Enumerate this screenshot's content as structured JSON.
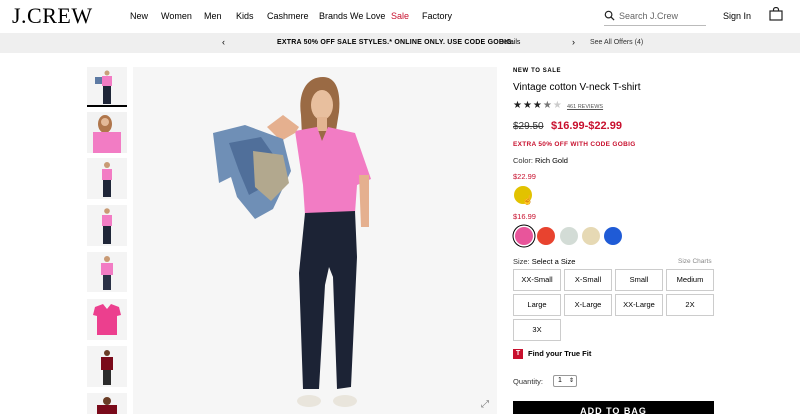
{
  "header": {
    "logo": "J.CREW",
    "nav": [
      "New",
      "Women",
      "Men",
      "Kids",
      "Cashmere",
      "Brands We Love",
      "Sale",
      "Factory"
    ],
    "search_placeholder": "Search J.Crew",
    "sign_in": "Sign In",
    "icons": {
      "search": "search-icon",
      "bag": "bag-icon"
    }
  },
  "promo": {
    "text": "EXTRA 50% OFF SALE STYLES.* ONLINE ONLY. USE CODE GOBIG.",
    "details": "Details",
    "all_offers": "See All Offers (4)"
  },
  "product": {
    "tag": "NEW TO SALE",
    "title": "Vintage cotton V-neck T-shirt",
    "rating": 3.5,
    "reviews": "461 REVIEWS",
    "old_price": "$29.50",
    "price_range": "$16.99-$22.99",
    "extra_offer": "EXTRA 50% OFF WITH CODE GOBIG",
    "color_label": "Color:",
    "color_value": "Rich Gold",
    "price_1": "$22.99",
    "price_2": "$16.99",
    "swatch_colors_1": [
      "#e2c200"
    ],
    "swatch_colors_2": [
      "#e8559b",
      "#e8432f",
      "#d3dcd6",
      "#e6d9b4",
      "#1f5bd6"
    ],
    "size_label": "Size:",
    "size_value": "Select a Size",
    "size_charts": "Size Charts",
    "sizes": [
      "XX-Small",
      "X-Small",
      "Small",
      "Medium",
      "Large",
      "X-Large",
      "XX-Large",
      "2X",
      "3X"
    ],
    "true_fit": "Find your True Fit",
    "true_fit_icon": "T",
    "quantity_label": "Quantity:",
    "quantity_value": "1",
    "add_to_bag": "ADD TO BAG"
  }
}
